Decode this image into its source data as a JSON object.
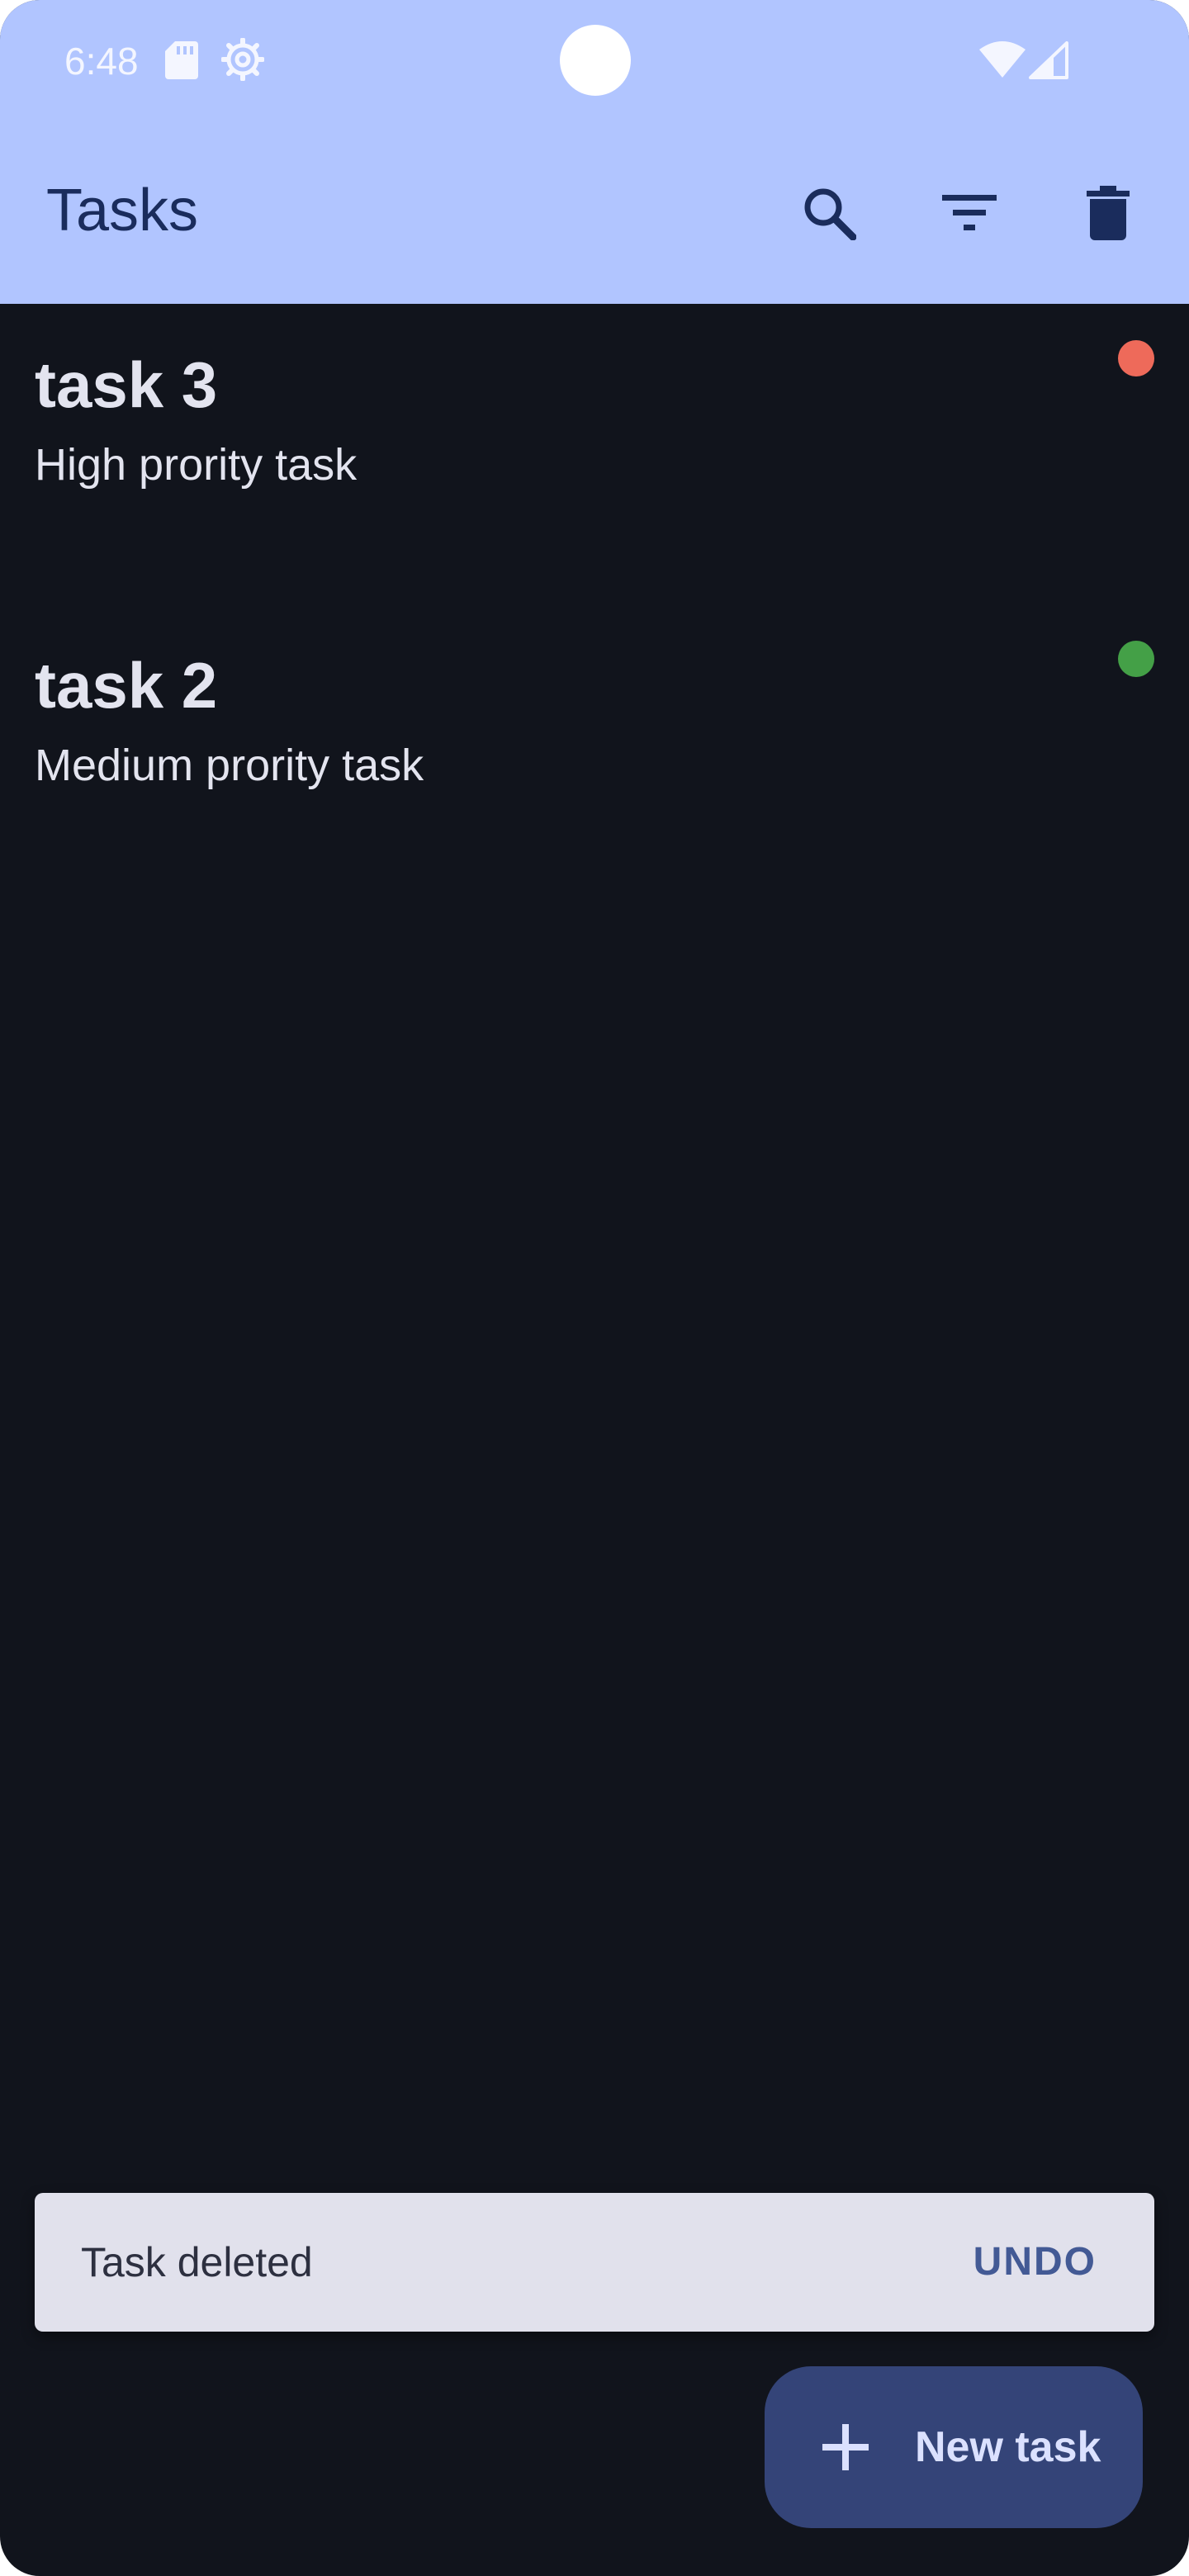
{
  "status_bar": {
    "time": "6:48",
    "icons": [
      "sd-card-icon",
      "settings-gear-icon",
      "wifi-icon",
      "cellular-signal-icon"
    ]
  },
  "app_bar": {
    "title": "Tasks",
    "actions": [
      "search-icon",
      "filter-icon",
      "delete-all-icon"
    ]
  },
  "tasks": [
    {
      "title": "task 3",
      "description": "High prority task",
      "priority": "high",
      "priority_color": "#ee6a5a"
    },
    {
      "title": "task 2",
      "description": "Medium prority task",
      "priority": "medium",
      "priority_color": "#44a047"
    }
  ],
  "snackbar": {
    "message": "Task deleted",
    "action_label": "UNDO"
  },
  "fab": {
    "label": "New task",
    "icon": "plus-icon"
  },
  "colors": {
    "app_bar_bg": "#b1c5ff",
    "app_bar_fg": "#1a2c5c",
    "background": "#11141c",
    "fab_bg": "#344478",
    "snackbar_bg": "#e1e1ec",
    "snackbar_action": "#435a95"
  }
}
